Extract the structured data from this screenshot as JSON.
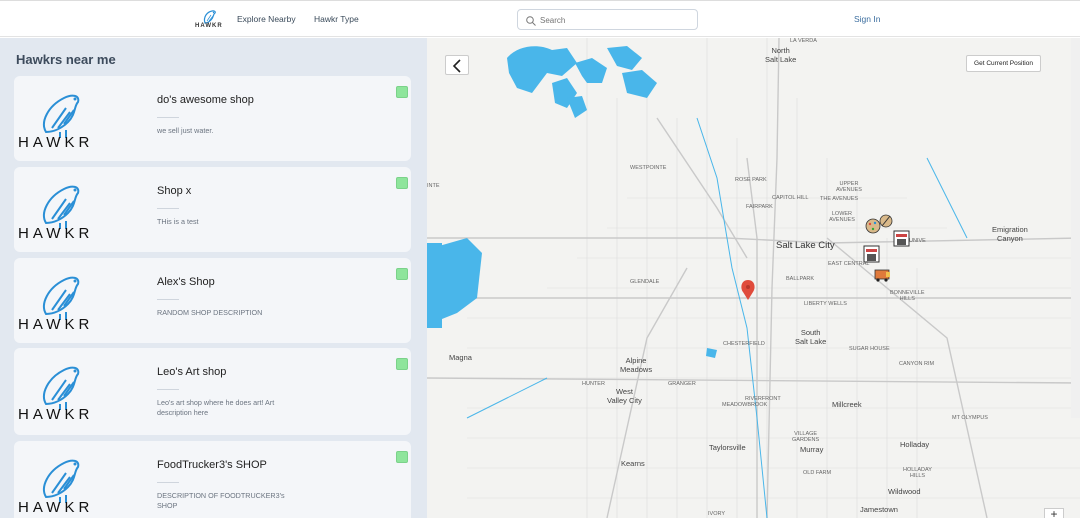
{
  "app": {
    "logo_text": "HAWKR",
    "logo_wordmark": "HAWKR"
  },
  "nav": {
    "explore": "Explore Nearby",
    "type": "Hawkr Type",
    "signin": "Sign In"
  },
  "search": {
    "placeholder": "Search"
  },
  "sidebar": {
    "title": "Hawkrs near me",
    "shops": [
      {
        "name": "do's awesome shop",
        "desc": "we sell just water."
      },
      {
        "name": "Shop x",
        "desc": "THis is a test"
      },
      {
        "name": "Alex's Shop",
        "desc": "RANDOM SHOP DESCRIPTION"
      },
      {
        "name": "Leo's Art shop",
        "desc": "Leo's art shop where he does art! Art description here"
      },
      {
        "name": "FoodTrucker3's SHOP",
        "desc": "DESCRIPTION OF FOODTRUCKER3's SHOP"
      }
    ]
  },
  "map": {
    "get_position": "Get Current Position",
    "zoom_in": "+",
    "labels": {
      "north_salt_lake": "North\nSalt Lake",
      "la_verda": "LA VERDA",
      "westpointe": "WESTPOINTE",
      "rose_park": "ROSE PARK",
      "capitol_hill": "CAPITOL HILL",
      "upper_avenues": "UPPER\nAVENUES",
      "fairpark": "FAIRPARK",
      "the_avenues": "THE AVENUES",
      "lower_avenues": "LOWER\nAVENUES",
      "salt_lake_city": "Salt Lake City",
      "emigration_canyon": "Emigration\nCanyon",
      "east_central": "EAST CENTRAL",
      "university": "UNIVE",
      "glendale": "GLENDALE",
      "ballpark": "BALLPARK",
      "liberty_wells": "LIBERTY WELLS",
      "bonneville_hills": "BONNEVILLE\nHILLS",
      "south_salt_lake": "South\nSalt Lake",
      "magna": "Magna",
      "chesterfield": "CHESTERFIELD",
      "sugar_house": "SUGAR HOUSE",
      "alpine_meadows": "Alpine\nMeadows",
      "canyon_rim": "CANYON RIM",
      "hunter": "HUNTER",
      "granger": "GRANGER",
      "west_valley_city": "West\nValley City",
      "riverfront": "RIVERFRONT",
      "meadowbrook": "MEADOWBROOK",
      "millcreek": "Millcreek",
      "mt_olympus": "MT OLYMPUS",
      "village_gardens": "VILLAGE\nGARDENS",
      "taylorsville": "Taylorsville",
      "holladay": "Holladay",
      "murray": "Murray",
      "kearns": "Kearns",
      "holladay_hills": "HOLLADAY\nHILLS",
      "old_farm": "OLD FARM",
      "wildwood": "Wildwood",
      "jamestown": "Jamestown",
      "ivory": "IVORY",
      "inte": "INTE"
    }
  },
  "colors": {
    "sidebar_bg": "#e2e8f0",
    "card_bg": "#f4f6f9",
    "status_green": "#8ee59c",
    "water": "#49b6ea",
    "pin": "#e04b3b",
    "brand_blue": "#2a8fd6"
  }
}
